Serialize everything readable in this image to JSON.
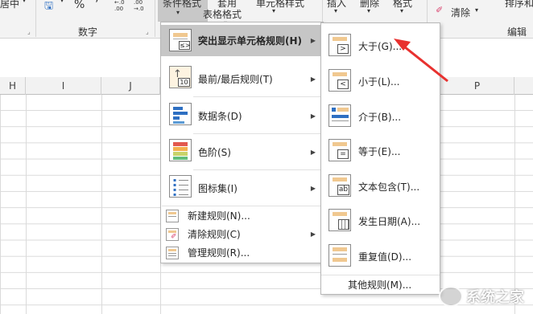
{
  "ribbon": {
    "cut_text": "居中",
    "number_group_label": "数字",
    "percent_symbol": "%",
    "comma_symbol": "’",
    "inc_decimal_text": "←.0 .00",
    "dec_decimal_text": ".00 →.0",
    "cond_format_label": "条件格式",
    "apply_table_label_top": "套用",
    "apply_table_label": "表格格式",
    "cell_style_label": "单元格样式",
    "insert_label": "插入",
    "delete_label": "删除",
    "format_label": "格式",
    "clear_label": "清除",
    "sort_label": "排序和",
    "edit_group_label": "编辑"
  },
  "columns": [
    "H",
    "I",
    "J",
    "",
    "",
    "",
    "",
    "",
    "",
    "P",
    ""
  ],
  "main_menu": {
    "items": [
      {
        "label": "突出显示单元格规则(H)",
        "icon": "highlight-rules-icon"
      },
      {
        "label": "最前/最后规则(T)",
        "icon": "top-bottom-icon"
      },
      {
        "label": "数据条(D)",
        "icon": "data-bars-icon"
      },
      {
        "label": "色阶(S)",
        "icon": "color-scales-icon"
      },
      {
        "label": "图标集(I)",
        "icon": "icon-sets-icon"
      }
    ],
    "small_items": [
      {
        "label": "新建规则(N)..."
      },
      {
        "label": "清除规则(C)"
      },
      {
        "label": "管理规则(R)..."
      }
    ]
  },
  "sub_menu": {
    "items": [
      {
        "label": "大于(G)...",
        "symbol": ">"
      },
      {
        "label": "小于(L)...",
        "symbol": "<"
      },
      {
        "label": "介于(B)...",
        "symbol": ""
      },
      {
        "label": "等于(E)...",
        "symbol": "="
      },
      {
        "label": "文本包含(T)...",
        "symbol": "ab"
      },
      {
        "label": "发生日期(A)...",
        "symbol": ""
      },
      {
        "label": "重复值(D)...",
        "symbol": ""
      }
    ],
    "more_label": "其他规则(M)..."
  },
  "colors": {
    "annotation_arrow": "#e8312f",
    "highlight_row": "#c6c6c6",
    "cell_accent": "#f0c890",
    "blue_accent": "#2e6fc2"
  },
  "watermark": "系统之家"
}
